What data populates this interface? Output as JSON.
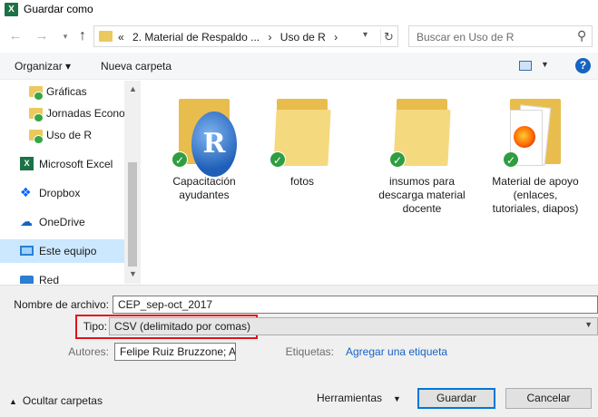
{
  "window": {
    "app_icon": "excel-icon",
    "title": "Guardar como"
  },
  "nav": {
    "back_icon": "back-arrow-icon",
    "forward_icon": "forward-arrow-icon",
    "recent_icon": "chevron-down-icon",
    "up_icon": "up-arrow-icon",
    "address_prefix": "«",
    "breadcrumbs": [
      "2. Material de Respaldo ...",
      "›",
      "Uso de R",
      "›"
    ],
    "search_placeholder": "Buscar en Uso de R"
  },
  "toolbar": {
    "organize": "Organizar ▾",
    "new_folder": "Nueva carpeta",
    "view_dropdown": "▼",
    "help": "?"
  },
  "sidebar": {
    "items": [
      {
        "label": "Gráficas",
        "icon": "folder-synced-icon"
      },
      {
        "label": "Jornadas Econor",
        "icon": "folder-synced-icon"
      },
      {
        "label": "Uso de R",
        "icon": "folder-synced-icon"
      },
      {
        "label": "Microsoft Excel",
        "icon": "excel-icon"
      },
      {
        "label": "Dropbox",
        "icon": "dropbox-icon"
      },
      {
        "label": "OneDrive",
        "icon": "onedrive-icon"
      },
      {
        "label": "Este equipo",
        "icon": "computer-icon"
      },
      {
        "label": "Red",
        "icon": "network-icon"
      }
    ]
  },
  "files": [
    {
      "name": "Capacitación ayudantes",
      "overlay": "r-logo"
    },
    {
      "name": "fotos",
      "overlay": "none"
    },
    {
      "name": "insumos para descarga material docente",
      "overlay": "none"
    },
    {
      "name": "Material de apoyo (enlaces, tutoriales, diapos)",
      "overlay": "documents"
    }
  ],
  "form": {
    "filename_label": "Nombre de archivo:",
    "filename_value": "CEP_sep-oct_2017",
    "type_label": "Tipo:",
    "type_value": "CSV (delimitado por comas)",
    "authors_label": "Autores:",
    "authors_value": "Felipe Ruiz Bruzzone; A",
    "tags_label": "Etiquetas:",
    "tags_link": "Agregar una etiqueta",
    "hide_folders": "Ocultar carpetas",
    "tools": "Herramientas",
    "save": "Guardar",
    "cancel": "Cancelar"
  },
  "colors": {
    "highlight": "#e0151a",
    "selection": "#cce8ff",
    "accent": "#0078d7",
    "sync_check": "#2f9e41"
  }
}
